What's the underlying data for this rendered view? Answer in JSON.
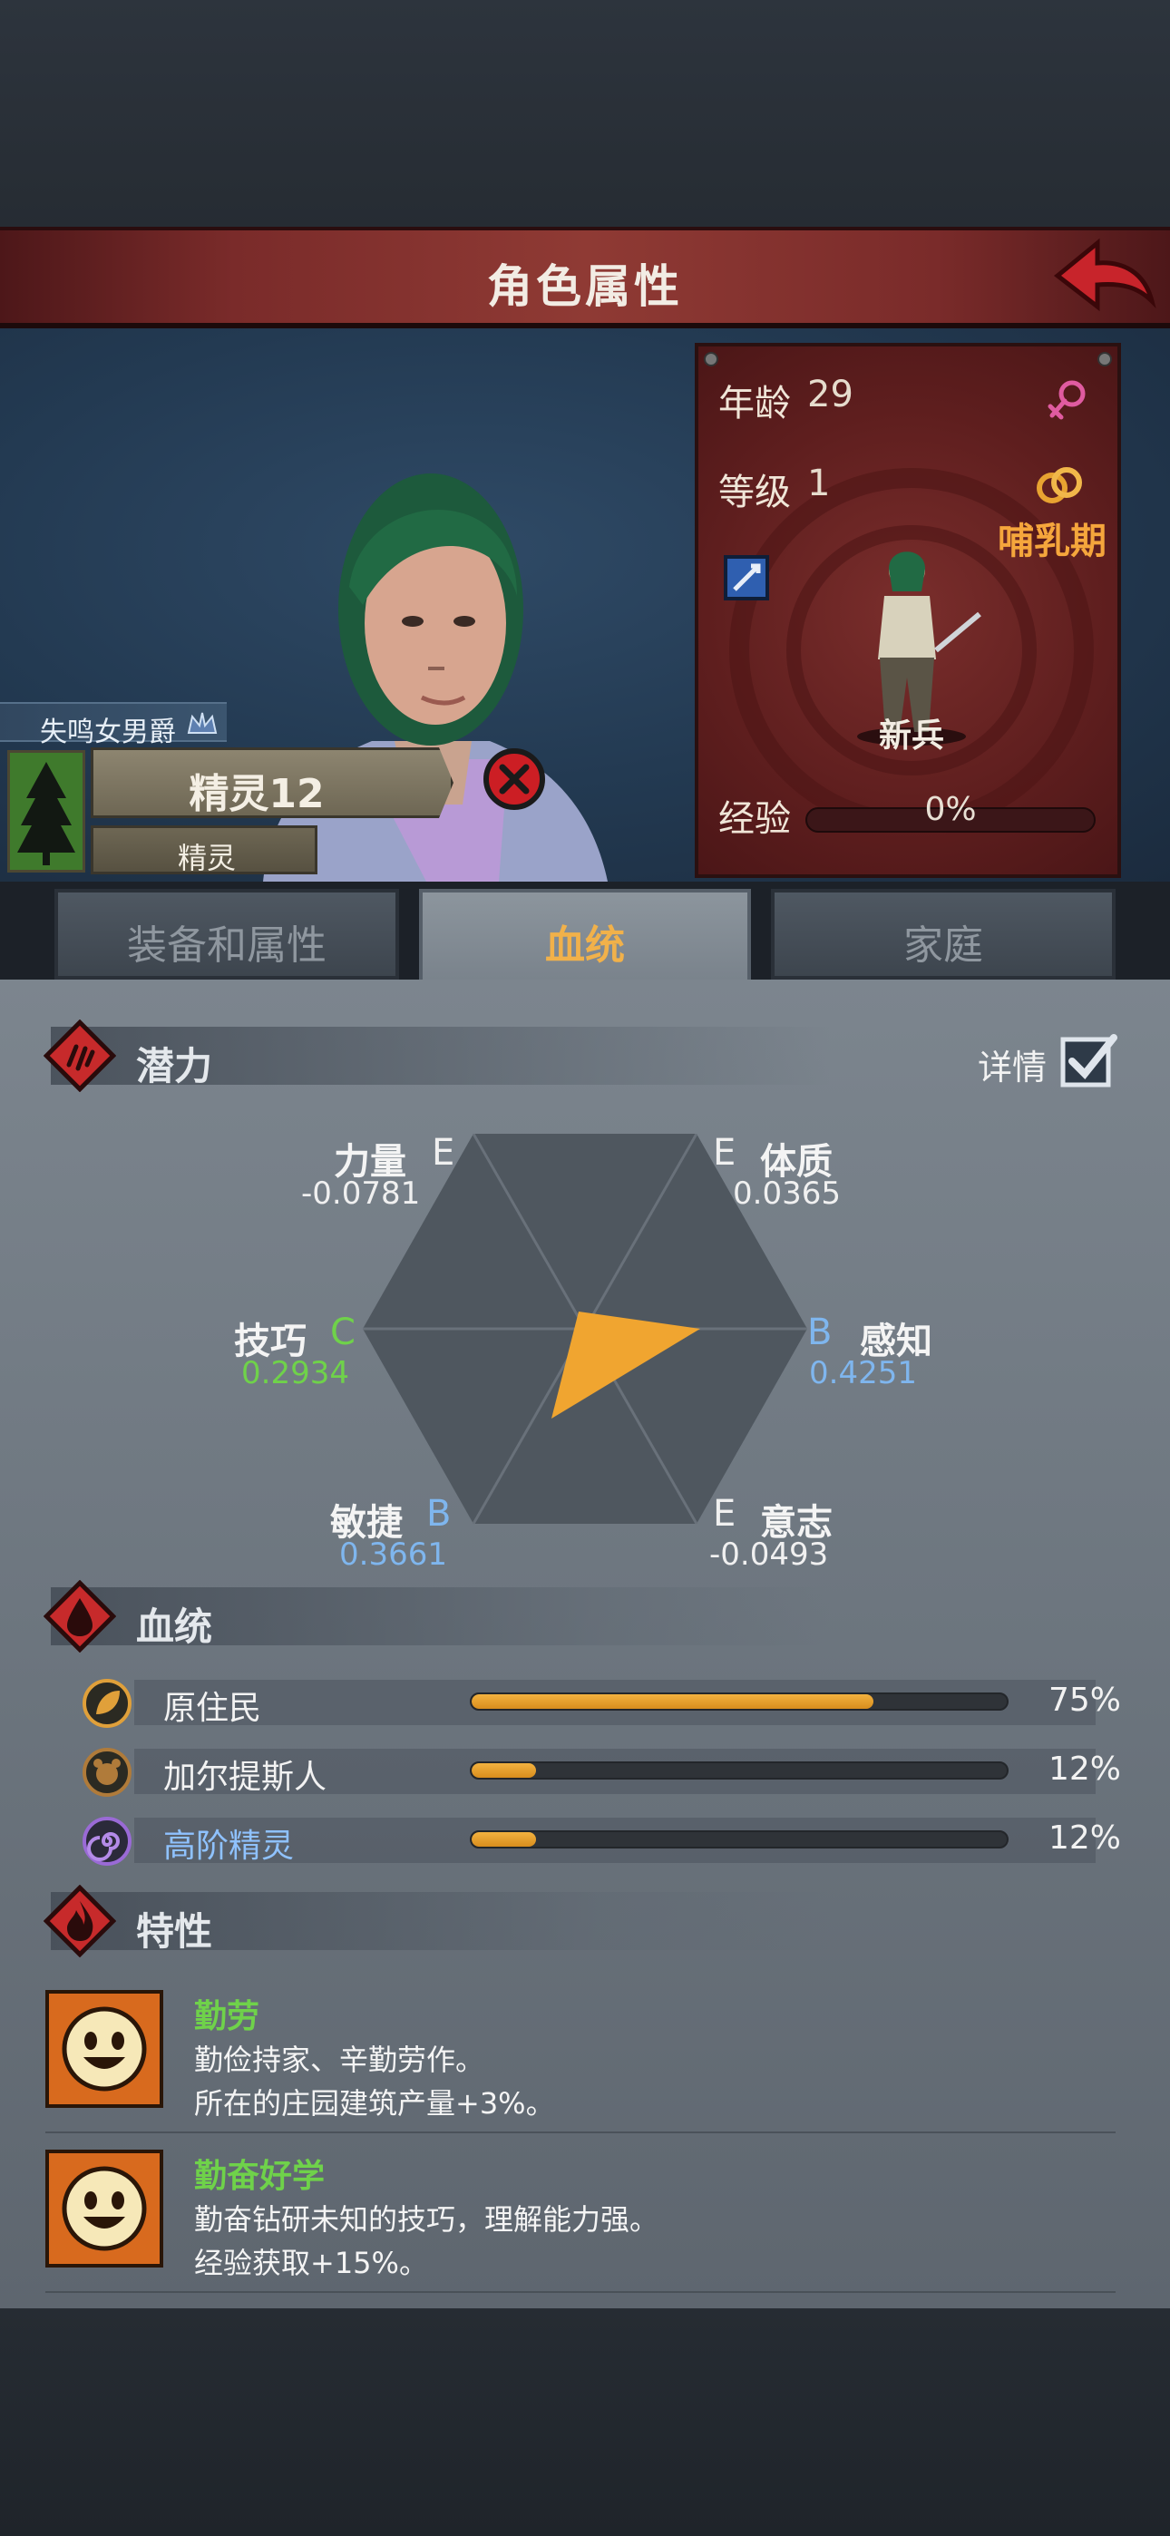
{
  "header": {
    "title": "角色属性"
  },
  "character": {
    "title_rank": "失鸣女男爵",
    "name": "精灵12",
    "race": "精灵",
    "age_label": "年龄",
    "age": "29",
    "level_label": "等级",
    "level": "1",
    "stage": "哺乳期",
    "unit_name": "新兵",
    "exp_label": "经验",
    "exp_pct": "0%",
    "exp_progress": 0
  },
  "tabs": [
    {
      "label": "装备和属性",
      "active": false
    },
    {
      "label": "血统",
      "active": true
    },
    {
      "label": "家庭",
      "active": false
    }
  ],
  "potential": {
    "title": "潜力",
    "details_label": "详情",
    "details_checked": true,
    "attributes": {
      "strength": {
        "name": "力量",
        "grade": "E",
        "value": "-0.0781"
      },
      "constitution": {
        "name": "体质",
        "grade": "E",
        "value": "0.0365"
      },
      "skill": {
        "name": "技巧",
        "grade": "C",
        "value": "0.2934"
      },
      "perception": {
        "name": "感知",
        "grade": "B",
        "value": "0.4251"
      },
      "agility": {
        "name": "敏捷",
        "grade": "B",
        "value": "0.3661"
      },
      "will": {
        "name": "意志",
        "grade": "E",
        "value": "-0.0493"
      }
    }
  },
  "bloodline": {
    "title": "血统",
    "items": [
      {
        "name": "原住民",
        "pct": "75%",
        "value": 75,
        "icon": "leaf-icon",
        "color": "#f2f2f2"
      },
      {
        "name": "加尔提斯人",
        "pct": "12%",
        "value": 12,
        "icon": "beast-icon",
        "color": "#f2f2f2"
      },
      {
        "name": "高阶精灵",
        "pct": "12%",
        "value": 12,
        "icon": "spiral-icon",
        "color": "#8fc2ff"
      }
    ]
  },
  "traits": {
    "title": "特性",
    "items": [
      {
        "name": "勤劳",
        "desc": "勤俭持家、辛勤劳作。",
        "effect": "所在的庄园建筑产量+3%。"
      },
      {
        "name": "勤奋好学",
        "desc": "勤奋钻研未知的技巧，理解能力强。",
        "effect": "经验获取+15%。"
      }
    ]
  },
  "colors": {
    "grade_e": "#f0f0f0",
    "grade_c": "#6fd24a",
    "grade_b": "#7fb6ee",
    "accent_orange": "#f2a53a",
    "trait_green": "#6fd24a"
  }
}
